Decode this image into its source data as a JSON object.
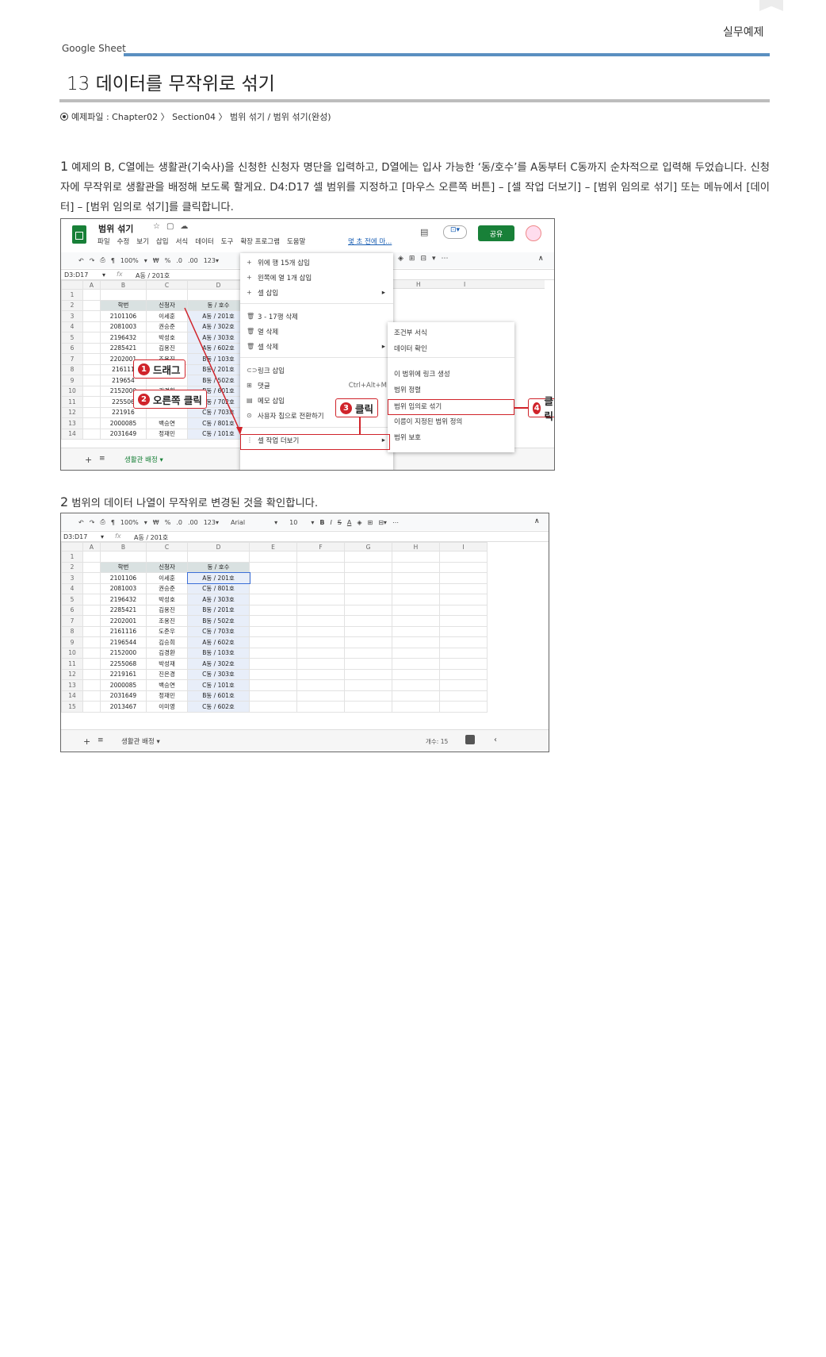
{
  "header": {
    "category": "실무예제",
    "brand": "Google Sheet",
    "title": "13 데이터를 무작위로 섞기",
    "example_file": "예제파일 : Chapter02 〉 Section04 〉 범위 섞기 / 범위 섞기(완성)"
  },
  "step1": {
    "num": "1",
    "text": "예제의 B, C열에는 생활관(기숙사)을 신청한 신청자 명단을 입력하고, D열에는 입사 가능한 ‘동/호수’를 A동부터 C동까지 순차적으로 입력해 두었습니다. 신청자에 무작위로 생활관을 배정해 보도록 할게요. D4:D17 셀 범위를 지정하고 [마우스 오른쪽 버튼] – [셀 작업 더보기] – [범위 임의로 섞기] 또는 메뉴에서 [데이터] – [범위 임의로 섞기]를 클릭합니다."
  },
  "step2": {
    "num": "2",
    "text": "범위의 데이터 나열이 무작위로 변경된 것을 확인합니다."
  },
  "colors": {
    "accent_red": "#d0232a",
    "rule_blue": "#5a8fc0",
    "sheets_green": "#188038"
  },
  "shot1": {
    "doc_title": "범위 섞기",
    "menus": [
      "파일",
      "수정",
      "보기",
      "삽입",
      "서식",
      "데이터",
      "도구",
      "확장 프로그램",
      "도움말"
    ],
    "last_edit": "몇 초 전에 마...",
    "share": "공유",
    "zoom": "100%",
    "name_box": "D3:D17",
    "formula": "A동 / 201호",
    "col_headers": [
      "A",
      "B",
      "C",
      "D"
    ],
    "far_cols": [
      "H",
      "I"
    ],
    "header_row": [
      "학번",
      "신청자",
      "동 / 호수"
    ],
    "rows": [
      [
        "2101106",
        "이세훈",
        "A동 / 201호"
      ],
      [
        "2081003",
        "권승준",
        "A동 / 302호"
      ],
      [
        "2196432",
        "박성호",
        "A동 / 303호"
      ],
      [
        "2285421",
        "김용진",
        "A동 / 602호"
      ],
      [
        "2202001",
        "조용진",
        "B동 / 103호"
      ],
      [
        "216111",
        "드래그",
        "B동 / 201호"
      ],
      [
        "219654",
        "",
        "B동 / 502호"
      ],
      [
        "2152000",
        "김경환",
        "B동 / 601호"
      ],
      [
        "225506",
        "",
        "C동 / 702호"
      ],
      [
        "221916",
        "",
        "C동 / 703호"
      ],
      [
        "2000085",
        "백승연",
        "C동 / 801호"
      ],
      [
        "2031649",
        "정재민",
        "C동 / 101호"
      ]
    ],
    "context_menu": [
      "위에 행 15개 삽입",
      "왼쪽에 열 1개 삽입",
      "셀 삽입",
      "3 - 17행 삭제",
      "열 삭제",
      "셀 삭제",
      "링크 삽입",
      "댓글",
      "메모 삽입",
      "사용자 칩으로 전환하기",
      "셀 작업 더보기"
    ],
    "comment_shortcut": "Ctrl+Alt+M",
    "submenu": [
      "조건부 서식",
      "데이터 확인",
      "이 범위에 링크 생성",
      "범위 정렬",
      "범위 임의로 섞기",
      "이름이 지정된 범위 정의",
      "범위 보호"
    ],
    "sheet_tab": "생활관 배정",
    "callouts": [
      {
        "num": "1",
        "label": "드래그"
      },
      {
        "num": "2",
        "label": "오른쪽 클릭"
      },
      {
        "num": "3",
        "label": "클릭"
      },
      {
        "num": "4",
        "label": "클릭"
      }
    ]
  },
  "shot2": {
    "zoom": "100%",
    "font": "Arial",
    "font_size": "10",
    "name_box": "D3:D17",
    "formula": "A동 / 201호",
    "col_headers": [
      "A",
      "B",
      "C",
      "D",
      "E",
      "F",
      "G",
      "H",
      "I"
    ],
    "header_row": [
      "학번",
      "신청자",
      "동 / 호수"
    ],
    "rows": [
      [
        "2101106",
        "이세훈",
        "A동 / 201호"
      ],
      [
        "2081003",
        "권승준",
        "C동 / 801호"
      ],
      [
        "2196432",
        "박성호",
        "A동 / 303호"
      ],
      [
        "2285421",
        "김용진",
        "B동 / 201호"
      ],
      [
        "2202001",
        "조용진",
        "B동 / 502호"
      ],
      [
        "2161116",
        "도준우",
        "C동 / 703호"
      ],
      [
        "2196544",
        "김승희",
        "A동 / 602호"
      ],
      [
        "2152000",
        "김경환",
        "B동 / 103호"
      ],
      [
        "2255068",
        "박성재",
        "A동 / 302호"
      ],
      [
        "2219161",
        "진은경",
        "C동 / 303호"
      ],
      [
        "2000085",
        "백승연",
        "C동 / 101호"
      ],
      [
        "2031649",
        "정재민",
        "B동 / 601호"
      ],
      [
        "2013467",
        "이미영",
        "C동 / 602호"
      ]
    ],
    "sheet_tab": "생활관 배정",
    "count": "개수: 15"
  }
}
